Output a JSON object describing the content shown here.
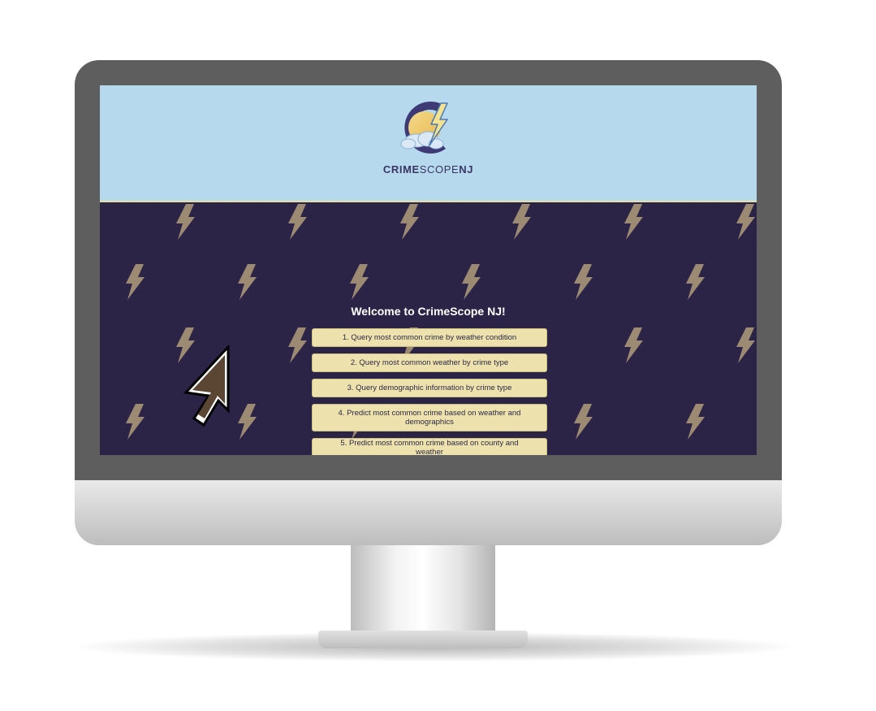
{
  "brand": {
    "part1": "CRIME",
    "part2": "SCOPE",
    "part3": "NJ"
  },
  "welcome": "Welcome to CrimeScope NJ!",
  "menu": [
    "1. Query most common crime by weather condition",
    "2. Query most common weather by crime type",
    "3. Query demographic information by crime type",
    "4. Predict most common crime based on weather and demographics",
    "5. Predict most common crime based on county and weather"
  ],
  "colors": {
    "header_bg": "#b6d9ee",
    "page_bg": "#2b2447",
    "button_bg": "#ede2ad",
    "bolt": "#9c8a73",
    "brand_text": "#3b3563"
  },
  "icons": {
    "logo": "crimescope-logo-icon",
    "pattern": "lightning-bolt-icon",
    "cursor": "mouse-pointer-icon"
  }
}
